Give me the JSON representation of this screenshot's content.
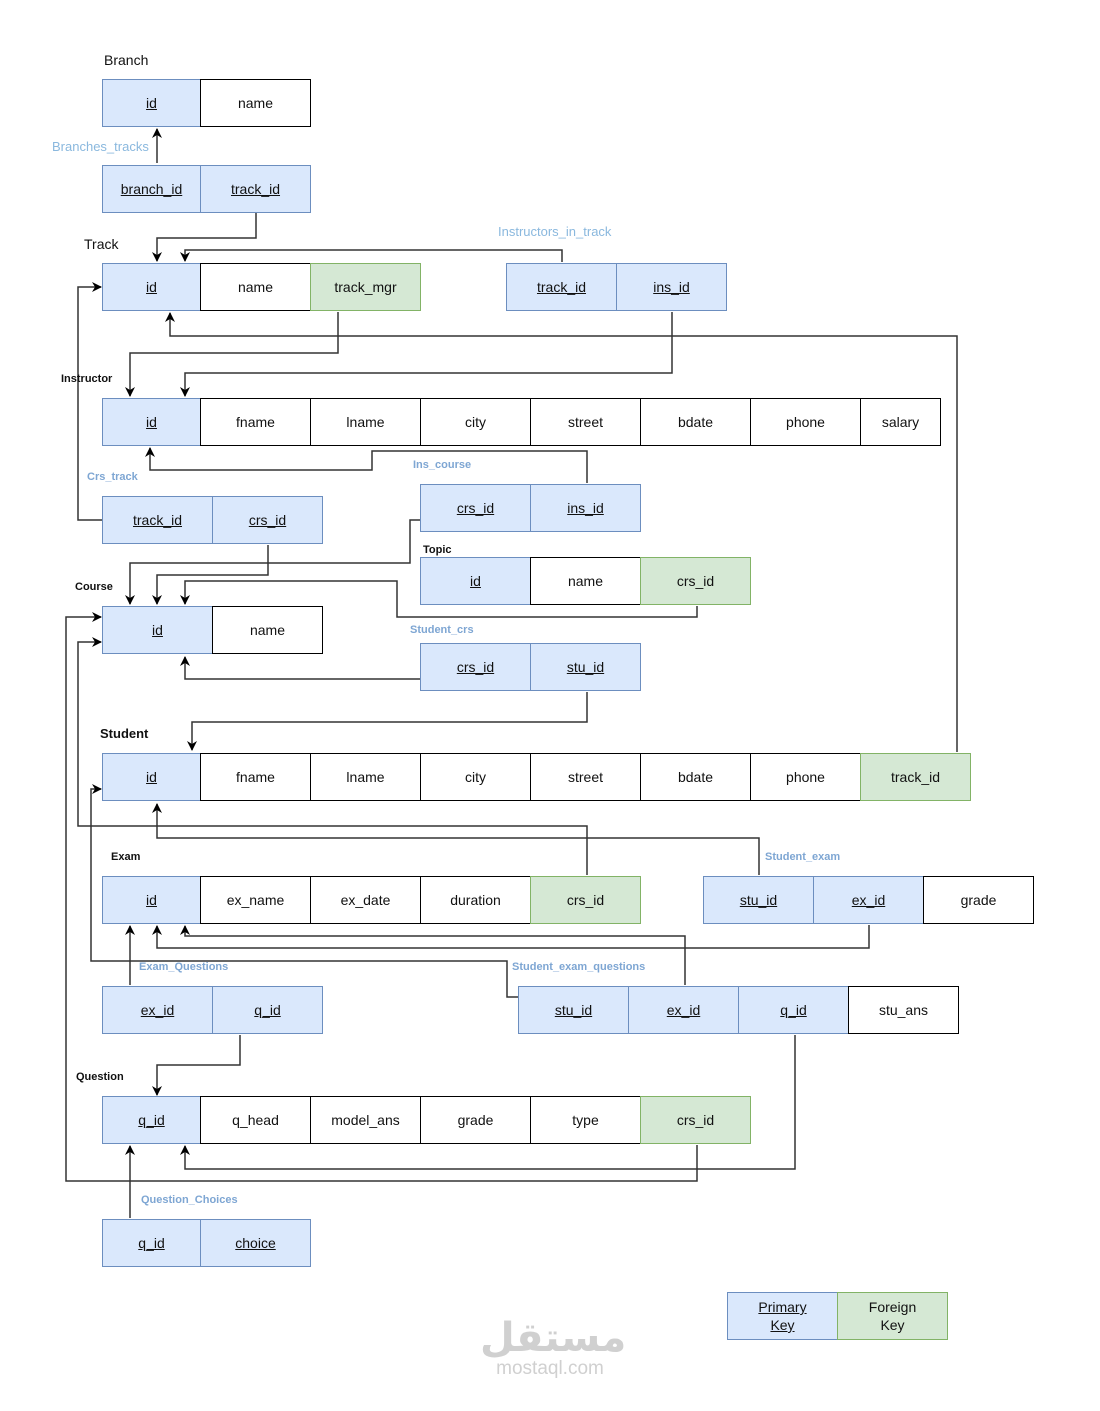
{
  "diagram": {
    "type": "relational-schema",
    "legend": {
      "primary_key": "Primary Key",
      "foreign_key": "Foreign Key",
      "colors": {
        "primary_key": "#dae8fc",
        "foreign_key": "#d5e8d4",
        "relation_label": "#7ea6d3"
      }
    },
    "tables": {
      "branch": {
        "label": "Branch",
        "columns": [
          {
            "name": "id",
            "key": "pk"
          },
          {
            "name": "name",
            "key": ""
          }
        ]
      },
      "branches_tracks": {
        "label": "Branches_tracks",
        "columns": [
          {
            "name": "branch_id",
            "key": "pk"
          },
          {
            "name": "track_id",
            "key": "pk"
          }
        ]
      },
      "track": {
        "label": "Track",
        "columns": [
          {
            "name": "id",
            "key": "pk"
          },
          {
            "name": "name",
            "key": ""
          },
          {
            "name": "track_mgr",
            "key": "fk"
          }
        ]
      },
      "instructors_in_track": {
        "label": "Instructors_in_track",
        "columns": [
          {
            "name": "track_id",
            "key": "pk"
          },
          {
            "name": "ins_id",
            "key": "pk"
          }
        ]
      },
      "instructor": {
        "label": "Instructor",
        "columns": [
          {
            "name": "id",
            "key": "pk"
          },
          {
            "name": "fname",
            "key": ""
          },
          {
            "name": "lname",
            "key": ""
          },
          {
            "name": "city",
            "key": ""
          },
          {
            "name": "street",
            "key": ""
          },
          {
            "name": "bdate",
            "key": ""
          },
          {
            "name": "phone",
            "key": ""
          },
          {
            "name": "salary",
            "key": ""
          }
        ]
      },
      "crs_track": {
        "label": "Crs_track",
        "columns": [
          {
            "name": "track_id",
            "key": "pk"
          },
          {
            "name": "crs_id",
            "key": "pk"
          }
        ]
      },
      "ins_course": {
        "label": "Ins_course",
        "columns": [
          {
            "name": "crs_id",
            "key": "pk"
          },
          {
            "name": "ins_id",
            "key": "pk"
          }
        ]
      },
      "topic": {
        "label": "Topic",
        "columns": [
          {
            "name": "id",
            "key": "pk"
          },
          {
            "name": "name",
            "key": ""
          },
          {
            "name": "crs_id",
            "key": "fk"
          }
        ]
      },
      "course": {
        "label": "Course",
        "columns": [
          {
            "name": "id",
            "key": "pk"
          },
          {
            "name": "name",
            "key": ""
          }
        ]
      },
      "student_crs": {
        "label": "Student_crs",
        "columns": [
          {
            "name": "crs_id",
            "key": "pk"
          },
          {
            "name": "stu_id",
            "key": "pk"
          }
        ]
      },
      "student": {
        "label": "Student",
        "columns": [
          {
            "name": "id",
            "key": "pk"
          },
          {
            "name": "fname",
            "key": ""
          },
          {
            "name": "lname",
            "key": ""
          },
          {
            "name": "city",
            "key": ""
          },
          {
            "name": "street",
            "key": ""
          },
          {
            "name": "bdate",
            "key": ""
          },
          {
            "name": "phone",
            "key": ""
          },
          {
            "name": "track_id",
            "key": "fk"
          }
        ]
      },
      "exam": {
        "label": "Exam",
        "columns": [
          {
            "name": "id",
            "key": "pk"
          },
          {
            "name": "ex_name",
            "key": ""
          },
          {
            "name": "ex_date",
            "key": ""
          },
          {
            "name": "duration",
            "key": ""
          },
          {
            "name": "crs_id",
            "key": "fk"
          }
        ]
      },
      "student_exam": {
        "label": "Student_exam",
        "columns": [
          {
            "name": "stu_id",
            "key": "pk"
          },
          {
            "name": "ex_id",
            "key": "pk"
          },
          {
            "name": "grade",
            "key": ""
          }
        ]
      },
      "exam_questions": {
        "label": "Exam_Questions",
        "columns": [
          {
            "name": "ex_id",
            "key": "pk"
          },
          {
            "name": "q_id",
            "key": "pk"
          }
        ]
      },
      "student_exam_questions": {
        "label": "Student_exam_questions",
        "columns": [
          {
            "name": "stu_id",
            "key": "pk"
          },
          {
            "name": "ex_id",
            "key": "pk"
          },
          {
            "name": "q_id",
            "key": "pk"
          },
          {
            "name": "stu_ans",
            "key": ""
          }
        ]
      },
      "question": {
        "label": "Question",
        "columns": [
          {
            "name": "q_id",
            "key": "pk"
          },
          {
            "name": "q_head",
            "key": ""
          },
          {
            "name": "model_ans",
            "key": ""
          },
          {
            "name": "grade",
            "key": ""
          },
          {
            "name": "type",
            "key": ""
          },
          {
            "name": "crs_id",
            "key": "fk"
          }
        ]
      },
      "question_choices": {
        "label": "Question_Choices",
        "columns": [
          {
            "name": "q_id",
            "key": "pk"
          },
          {
            "name": "choice",
            "key": "pk"
          }
        ]
      }
    },
    "relationships": [
      {
        "from": "branches_tracks.branch_id",
        "to": "branch.id"
      },
      {
        "from": "branches_tracks.track_id",
        "to": "track.id"
      },
      {
        "from": "instructors_in_track.track_id",
        "to": "track.id"
      },
      {
        "from": "instructors_in_track.ins_id",
        "to": "instructor.id"
      },
      {
        "from": "track.track_mgr",
        "to": "instructor.id"
      },
      {
        "from": "student.track_id",
        "to": "track.id"
      },
      {
        "from": "crs_track.track_id",
        "to": "track.id"
      },
      {
        "from": "crs_track.crs_id",
        "to": "course.id"
      },
      {
        "from": "ins_course.ins_id",
        "to": "instructor.id"
      },
      {
        "from": "ins_course.crs_id",
        "to": "course.id"
      },
      {
        "from": "topic.crs_id",
        "to": "course.id"
      },
      {
        "from": "student_crs.crs_id",
        "to": "course.id"
      },
      {
        "from": "student_crs.stu_id",
        "to": "student.id"
      },
      {
        "from": "exam.crs_id",
        "to": "course.id"
      },
      {
        "from": "student_exam.stu_id",
        "to": "student.id"
      },
      {
        "from": "student_exam.ex_id",
        "to": "exam.id"
      },
      {
        "from": "exam_questions.ex_id",
        "to": "exam.id"
      },
      {
        "from": "exam_questions.q_id",
        "to": "question.id"
      },
      {
        "from": "student_exam_questions.stu_id",
        "to": "student.id"
      },
      {
        "from": "student_exam_questions.ex_id",
        "to": "exam.id"
      },
      {
        "from": "student_exam_questions.q_id",
        "to": "question.q_id"
      },
      {
        "from": "question.crs_id",
        "to": "course.id"
      },
      {
        "from": "question_choices.q_id",
        "to": "question.q_id"
      }
    ]
  },
  "watermark": {
    "arabic": "مستقل",
    "latin": "mostaql.com"
  }
}
